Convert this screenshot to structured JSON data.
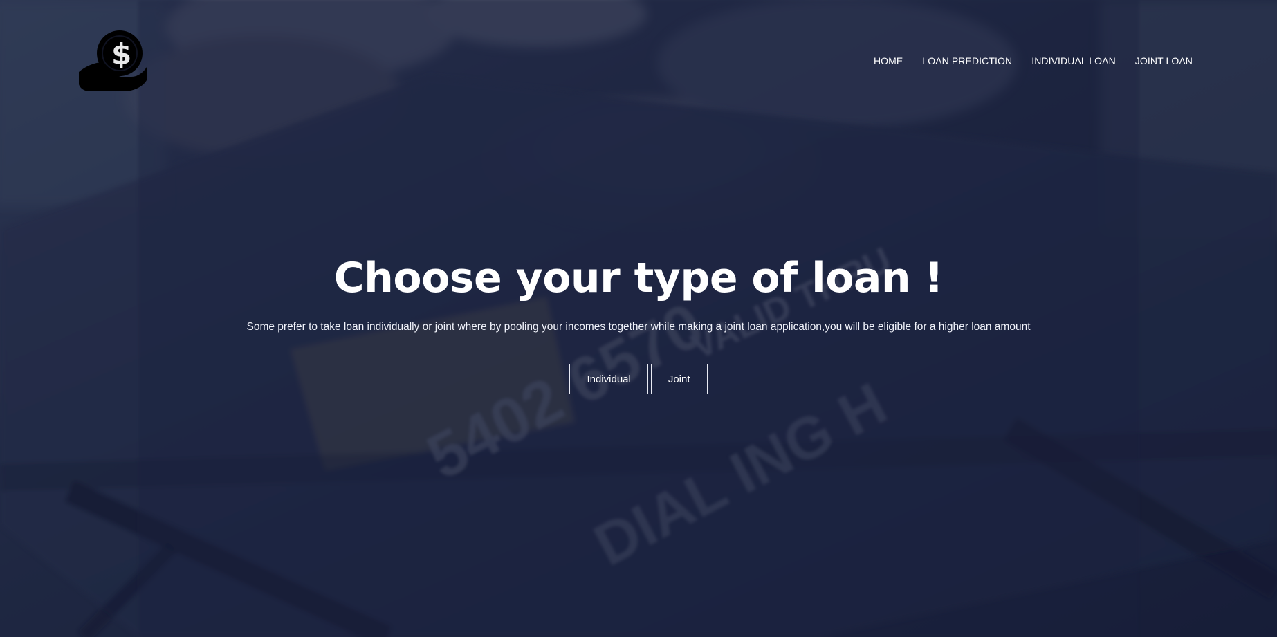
{
  "brand": {
    "logo_icon": "hand-dollar-coin-icon"
  },
  "nav": {
    "items": [
      {
        "label": "HOME"
      },
      {
        "label": "LOAN PREDICTION"
      },
      {
        "label": "INDIVIDUAL LOAN"
      },
      {
        "label": "JOINT LOAN"
      }
    ]
  },
  "hero": {
    "title": "Choose your type of loan !",
    "description": "Some prefer to take loan individually or joint where by pooling your incomes together while making a joint loan application,you will be eligible for a higher loan amount",
    "buttons": {
      "individual": "Individual",
      "joint": "Joint"
    }
  },
  "colors": {
    "overlay": "#181f3c",
    "text": "#ffffff",
    "button_border": "#e8eaf3"
  }
}
